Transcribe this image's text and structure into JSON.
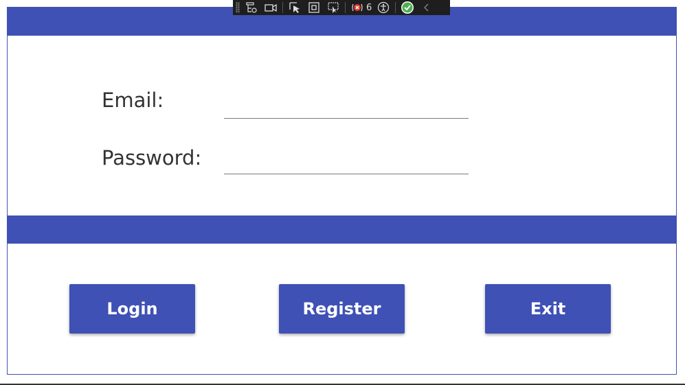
{
  "form": {
    "email_label": "Email:",
    "email_value": "",
    "password_label": "Password:",
    "password_value": ""
  },
  "buttons": {
    "login": "Login",
    "register": "Register",
    "exit": "Exit"
  },
  "debug_toolbar": {
    "error_count": "6",
    "icons": [
      "visual-tree-icon",
      "record-icon",
      "select-element-icon",
      "display-layout-adorners-icon",
      "track-focus-icon",
      "binding-failures-icon",
      "accessibility-icon",
      "hot-reload-status-icon",
      "collapse-icon"
    ]
  },
  "colors": {
    "accent": "#3f51b5",
    "text": "#333333",
    "toolbar_bg": "#1e1e1e",
    "status_ok": "#4caf50",
    "error": "#e53935"
  }
}
